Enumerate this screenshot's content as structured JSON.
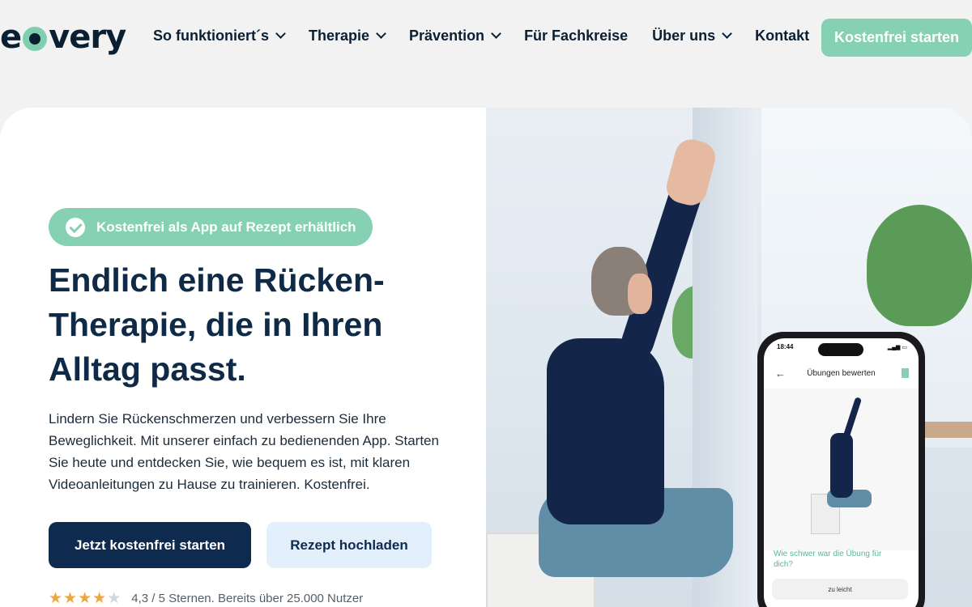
{
  "header": {
    "logo_text": "e",
    "logo_text_end": "very",
    "nav": [
      {
        "label": "So funktioniert´s",
        "dropdown": true
      },
      {
        "label": "Therapie",
        "dropdown": true
      },
      {
        "label": "Prävention",
        "dropdown": true
      },
      {
        "label": "Für Fachkreise",
        "dropdown": false
      },
      {
        "label": "Über uns",
        "dropdown": true
      },
      {
        "label": "Kontakt",
        "dropdown": false
      }
    ],
    "cta_label": "Kostenfrei starten"
  },
  "hero": {
    "badge_label": "Kostenfrei als App auf Rezept erhältlich",
    "headline": "Endlich eine Rücken-Therapie, die in Ihren Alltag passt.",
    "intro": "Lindern Sie Rückenschmerzen und verbessern Sie Ihre Beweglichkeit. Mit unserer einfach zu bedienenden App. Starten Sie heute und entdecken Sie, wie bequem es ist, mit klaren Videoanleitungen zu Hause zu trainieren. Kostenfrei.",
    "primary_button": "Jetzt kostenfrei starten",
    "secondary_button": "Rezept hochladen",
    "rating_text": "4,3 / 5 Sternen. Bereits über 25.000 Nutzer",
    "rating_value": 4.3
  },
  "phone": {
    "time": "18:44",
    "title": "Übungen bewerten",
    "question": "Wie schwer war die Übung für dich?",
    "answer": "zu leicht"
  },
  "colors": {
    "accent": "#86d1b3",
    "primary": "#0e2a4f",
    "background": "#f2f2f2"
  }
}
